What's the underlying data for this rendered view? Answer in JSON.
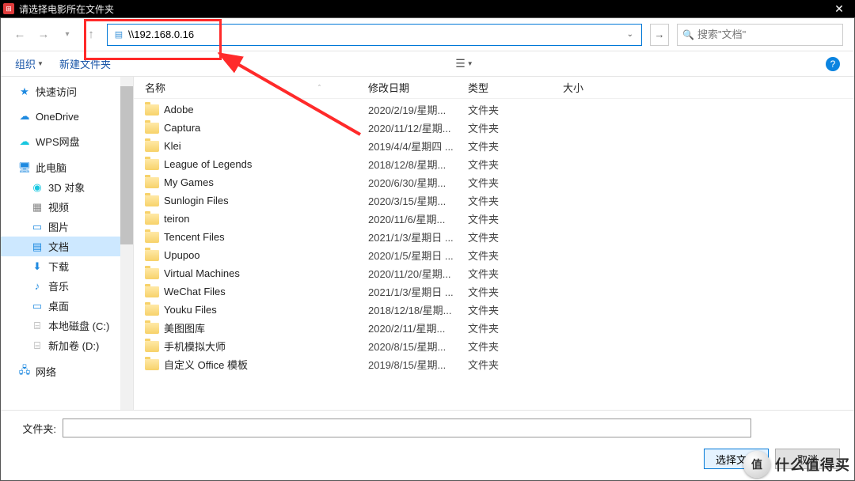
{
  "title": "请选择电影所在文件夹",
  "address_bar": {
    "value": "\\\\192.168.0.16"
  },
  "search": {
    "placeholder": "搜索\"文档\""
  },
  "toolbar": {
    "organize": "组织",
    "new_folder": "新建文件夹"
  },
  "columns": {
    "name": "名称",
    "date": "修改日期",
    "type": "类型",
    "size": "大小"
  },
  "sidebar": {
    "quick_access": "快速访问",
    "onedrive": "OneDrive",
    "wps": "WPS网盘",
    "this_pc": "此电脑",
    "objects3d": "3D 对象",
    "videos": "视频",
    "pictures": "图片",
    "documents": "文档",
    "downloads": "下载",
    "music": "音乐",
    "desktop": "桌面",
    "localdisk_c": "本地磁盘 (C:)",
    "newvol_d": "新加卷 (D:)",
    "network": "网络"
  },
  "files": [
    {
      "name": "Adobe",
      "date": "2020/2/19/星期...",
      "type": "文件夹"
    },
    {
      "name": "Captura",
      "date": "2020/11/12/星期...",
      "type": "文件夹"
    },
    {
      "name": "Klei",
      "date": "2019/4/4/星期四 ...",
      "type": "文件夹"
    },
    {
      "name": "League of Legends",
      "date": "2018/12/8/星期...",
      "type": "文件夹"
    },
    {
      "name": "My Games",
      "date": "2020/6/30/星期...",
      "type": "文件夹"
    },
    {
      "name": "Sunlogin Files",
      "date": "2020/3/15/星期...",
      "type": "文件夹"
    },
    {
      "name": "teiron",
      "date": "2020/11/6/星期...",
      "type": "文件夹"
    },
    {
      "name": "Tencent Files",
      "date": "2021/1/3/星期日 ...",
      "type": "文件夹"
    },
    {
      "name": "Upupoo",
      "date": "2020/1/5/星期日 ...",
      "type": "文件夹"
    },
    {
      "name": "Virtual Machines",
      "date": "2020/11/20/星期...",
      "type": "文件夹"
    },
    {
      "name": "WeChat Files",
      "date": "2021/1/3/星期日 ...",
      "type": "文件夹"
    },
    {
      "name": "Youku Files",
      "date": "2018/12/18/星期...",
      "type": "文件夹"
    },
    {
      "name": "美图图库",
      "date": "2020/2/11/星期...",
      "type": "文件夹"
    },
    {
      "name": "手机模拟大师",
      "date": "2020/8/15/星期...",
      "type": "文件夹"
    },
    {
      "name": "自定义 Office 模板",
      "date": "2019/8/15/星期...",
      "type": "文件夹"
    }
  ],
  "footer": {
    "folder_label": "文件夹:",
    "select": "选择文件",
    "cancel": "取消"
  },
  "watermark": {
    "badge": "值",
    "text": "什么值得买"
  }
}
